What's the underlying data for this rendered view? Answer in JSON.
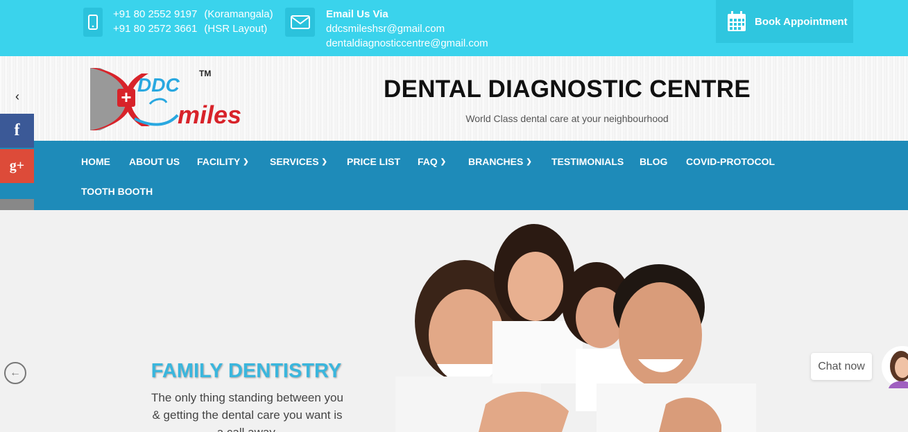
{
  "topbar": {
    "phones": [
      {
        "number": "+91 80 2552 9197",
        "location": "(Koramangala)"
      },
      {
        "number": "+91 80 2572 3661",
        "location": "(HSR Layout)"
      }
    ],
    "email_heading": "Email Us Via",
    "emails": [
      "ddcsmileshsr@gmail.com",
      "dentaldiagnosticcentre@gmail.com"
    ],
    "book_label": "Book Appointment"
  },
  "header": {
    "logo_text": "DDC Smiles",
    "logo_tm": "TM",
    "title": "DENTAL DIAGNOSTIC CENTRE",
    "tagline": "World Class dental care at your neighbourhood"
  },
  "nav": {
    "items": [
      {
        "label": "HOME",
        "dropdown": false
      },
      {
        "label": "ABOUT US",
        "dropdown": false
      },
      {
        "label": "FACILITY",
        "dropdown": true
      },
      {
        "label": "SERVICES",
        "dropdown": true
      },
      {
        "label": "PRICE LIST",
        "dropdown": false
      },
      {
        "label": "FAQ",
        "dropdown": true
      },
      {
        "label": "BRANCHES",
        "dropdown": true
      },
      {
        "label": "TESTIMONIALS",
        "dropdown": false
      },
      {
        "label": "BLOG",
        "dropdown": false
      },
      {
        "label": "COVID-PROTOCOL",
        "dropdown": false
      },
      {
        "label": "TOOTH BOOTH",
        "dropdown": false
      }
    ]
  },
  "social": {
    "facebook_glyph": "f",
    "googleplus_glyph": "g+"
  },
  "hero": {
    "title": "FAMILY DENTISTRY",
    "subtitle": "The only thing standing between you & getting the dental care you want is a call away."
  },
  "chat": {
    "label": "Chat now"
  },
  "colors": {
    "topbar": "#3ad3ec",
    "nav": "#1e8bb9",
    "accent": "#3ab6dd",
    "facebook": "#3b5997",
    "googleplus": "#dd4b39"
  }
}
